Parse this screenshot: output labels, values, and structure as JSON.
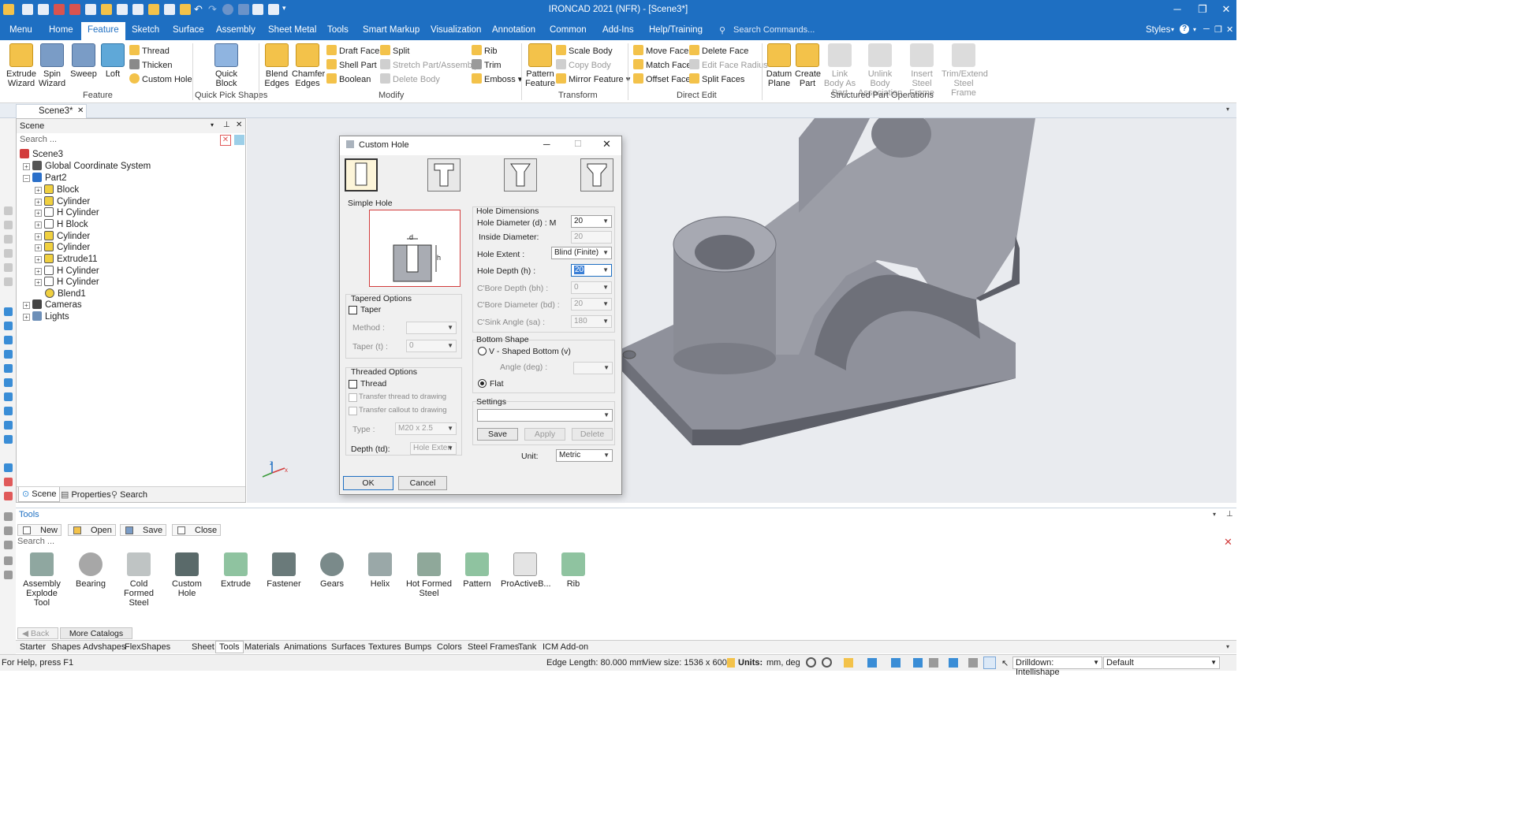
{
  "window": {
    "title": "IRONCAD 2021 (NFR) - [Scene3*]",
    "controls": {
      "minimize": "─",
      "restore": "❐",
      "close": "✕"
    }
  },
  "menu": {
    "items": [
      "Menu",
      "Home",
      "Feature",
      "Sketch",
      "Surface",
      "Assembly",
      "Sheet Metal",
      "Tools",
      "Smart Markup",
      "Visualization",
      "Annotation",
      "Common",
      "Add-Ins",
      "Help/Training"
    ],
    "active": "Feature",
    "search_placeholder": "Search Commands...",
    "styles_label": "Styles"
  },
  "ribbon": {
    "feature_group": {
      "label": "Feature",
      "extrude": "Extrude Wizard",
      "spin": "Spin Wizard",
      "sweep": "Sweep",
      "loft": "Loft",
      "thread": "Thread",
      "thicken": "Thicken",
      "custom_hole": "Custom Hole"
    },
    "quickpick_group": {
      "label": "Quick Pick Shapes",
      "quick_block": "Quick Block"
    },
    "modify_group": {
      "label": "Modify",
      "blend": "Blend Edges",
      "chamfer": "Chamfer Edges",
      "draft": "Draft Faces",
      "shell": "Shell Part",
      "boolean": "Boolean",
      "split": "Split",
      "stretch": "Stretch Part/Assembly",
      "delete_body": "Delete Body",
      "rib": "Rib",
      "trim": "Trim",
      "emboss": "Emboss"
    },
    "transform_group": {
      "label": "Transform",
      "pattern": "Pattern Feature",
      "scale": "Scale Body",
      "copy": "Copy Body",
      "mirror": "Mirror Feature"
    },
    "directedit_group": {
      "label": "Direct Edit",
      "move_face": "Move Face",
      "match_face": "Match Face",
      "offset_face": "Offset Face",
      "delete_face": "Delete Face",
      "edit_radius": "Edit Face Radius",
      "split_faces": "Split Faces"
    },
    "structured_group": {
      "label": "Structured Part Operations",
      "datum": "Datum Plane",
      "create_part": "Create Part",
      "link_body": "Link Body As Part",
      "unlink_body": "Unlink Body Association",
      "insert_steel": "Insert Steel Frame",
      "trim_steel": "Trim/Extend Steel Frame"
    }
  },
  "doc_tab": "Scene3*",
  "scene_panel": {
    "title": "Scene",
    "search_placeholder": "Search ...",
    "tree": [
      "Scene3",
      "Global Coordinate System",
      "Part2",
      "Block",
      "Cylinder",
      "H Cylinder",
      "H Block",
      "Cylinder",
      "Cylinder",
      "Extrude11",
      "H Cylinder",
      "H Cylinder",
      "Blend1",
      "Cameras",
      "Lights"
    ],
    "tabs": [
      "Scene",
      "Properties",
      "Search"
    ]
  },
  "dialog": {
    "title": "Custom Hole",
    "hole_type": "Simple Hole",
    "tapered": {
      "title": "Tapered Options",
      "taper": "Taper",
      "method_label": "Method :",
      "method_value": "",
      "taper_label": "Taper (t) :",
      "taper_value": "0"
    },
    "threaded": {
      "title": "Threaded Options",
      "thread": "Thread",
      "transfer_drawing": "Transfer thread to drawing",
      "transfer_callout": "Transfer callout to drawing",
      "type_label": "Type :",
      "type_value": "M20 x 2.5",
      "depth_label": "Depth (td):",
      "depth_value": "Hole Exten"
    },
    "dims": {
      "title": "Hole Dimensions",
      "diameter_label": "Hole Diameter (d) : M",
      "diameter_value": "20",
      "inside_label": "Inside Diameter:",
      "inside_value": "20",
      "extent_label": "Hole Extent :",
      "extent_value": "Blind (Finite)",
      "depth_label": "Hole Depth (h) :",
      "depth_value": "20",
      "cbore_depth_label": "C'Bore Depth (bh) :",
      "cbore_depth_value": "0",
      "cbore_diam_label": "C'Bore Diameter (bd) :",
      "cbore_diam_value": "20",
      "csink_label": "C'Sink Angle (sa) :",
      "csink_value": "180"
    },
    "bottom": {
      "title": "Bottom Shape",
      "v_shaped": "V - Shaped Bottom (v)",
      "angle_label": "Angle (deg) :",
      "angle_value": "",
      "flat": "Flat"
    },
    "settings": {
      "title": "Settings",
      "value": "",
      "save": "Save",
      "apply": "Apply",
      "delete": "Delete"
    },
    "unit_label": "Unit:",
    "unit_value": "Metric",
    "ok": "OK",
    "cancel": "Cancel"
  },
  "tools_panel": {
    "title": "Tools",
    "buttons": [
      "New",
      "Open",
      "Save",
      "Close"
    ],
    "search_placeholder": "Search ...",
    "items": [
      "Assembly Explode Tool",
      "Bearing",
      "Cold Formed Steel",
      "Custom Hole",
      "Extrude",
      "Fastener",
      "Gears",
      "Helix",
      "Hot Formed Steel",
      "Pattern",
      "ProActiveB...",
      "Rib"
    ],
    "back": "Back",
    "more_catalogs": "More Catalogs"
  },
  "catalog_tabs": [
    "Starter",
    "Shapes",
    "Advshapes",
    "FlexShapes",
    "Sheet Metal",
    "Tools",
    "Materials",
    "Animations",
    "Surfaces",
    "Textures",
    "Bumps",
    "Colors",
    "Steel Frames",
    "Tank",
    "ICM Add-on"
  ],
  "catalog_active": "Tools",
  "status": {
    "help": "For Help, press F1",
    "edge_length": "Edge Length: 80.000 mm",
    "view_size": "View size: 1536 x  600",
    "units_label": "Units:",
    "units_value": "mm, deg",
    "drilldown": "Drilldown: Intellishape",
    "default": "Default"
  },
  "colors": {
    "accent": "#1e6fc2",
    "model_gray": "#8f919b"
  }
}
